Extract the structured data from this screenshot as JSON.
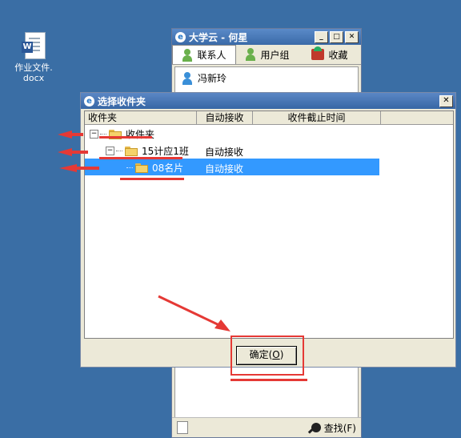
{
  "desktop_icon": {
    "label_line1": "作业文件.",
    "label_line2": "docx"
  },
  "back_window": {
    "title": "大学云 - 何星",
    "tabs": [
      {
        "label": "联系人"
      },
      {
        "label": "用户组"
      },
      {
        "label": "收藏"
      }
    ],
    "contacts": [
      {
        "name": "冯新玲"
      }
    ],
    "status": {
      "find_label": "查找(F)"
    }
  },
  "dialog": {
    "title": "选择收件夹",
    "close_glyph": "✕",
    "columns": [
      "收件夹",
      "自动接收",
      "收件截止时间",
      ""
    ],
    "tree": [
      {
        "name": "收件夹",
        "auto": "",
        "level": 0,
        "expander": "−"
      },
      {
        "name": "15计应1班",
        "auto": "自动接收",
        "level": 1,
        "expander": "−"
      },
      {
        "name": "08名片",
        "auto": "自动接收",
        "level": 2,
        "selected": true
      }
    ],
    "ok_label": "确定(",
    "ok_key": "O",
    "ok_end": ")"
  },
  "colors": {
    "desktop": "#3a6ea5",
    "selection": "#3399ff",
    "annotation": "#e53935"
  }
}
